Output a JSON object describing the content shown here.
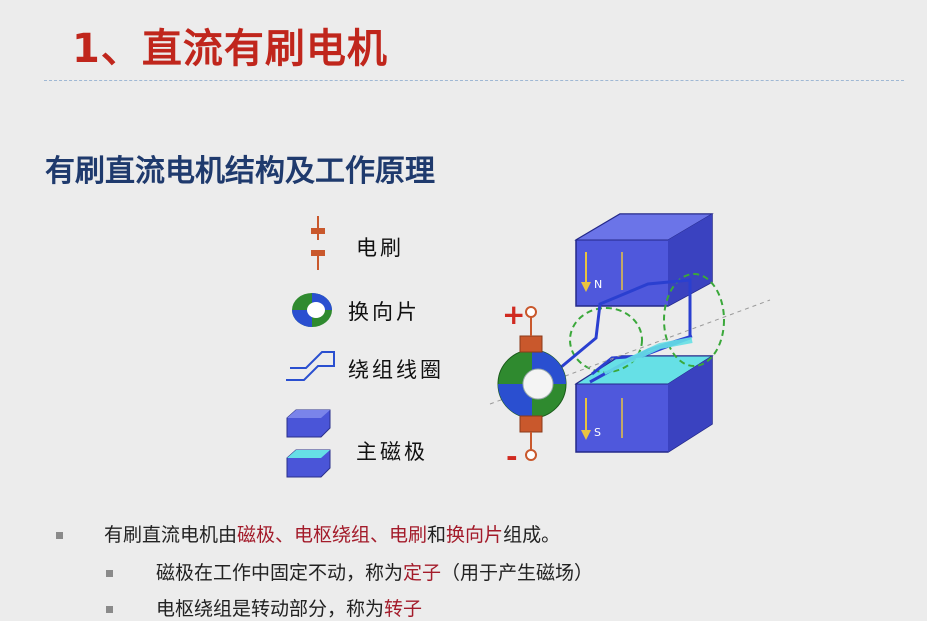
{
  "title": "1、直流有刷电机",
  "subtitle": "有刷直流电机结构及工作原理",
  "legend": {
    "brush": "电刷",
    "commutator": "换向片",
    "coil": "绕组线圈",
    "magnet": "主磁极"
  },
  "diagram": {
    "plus": "+",
    "minus": "-",
    "north": "N",
    "south": "S"
  },
  "bullets": {
    "b1": {
      "p1": "有刷直流电机由",
      "h1": "磁极、电枢绕组、电刷",
      "p2": "和",
      "h2": "换向片",
      "p3": "组成。"
    },
    "b2": {
      "p1": "磁极在工作中固定不动，称为",
      "h1": "定子",
      "p2": "（用于产生磁场）"
    },
    "b3": {
      "p1": "电枢绕组是转动部分，称为",
      "h1": "转子"
    }
  },
  "colors": {
    "title": "#c0261c",
    "subtitle": "#1f3a6d",
    "magnet": "#4a55d8",
    "commutator_green": "#2f8a2f",
    "commutator_blue": "#2a4fd0",
    "brush": "#c9582c",
    "highlight": "#a31b2a"
  }
}
